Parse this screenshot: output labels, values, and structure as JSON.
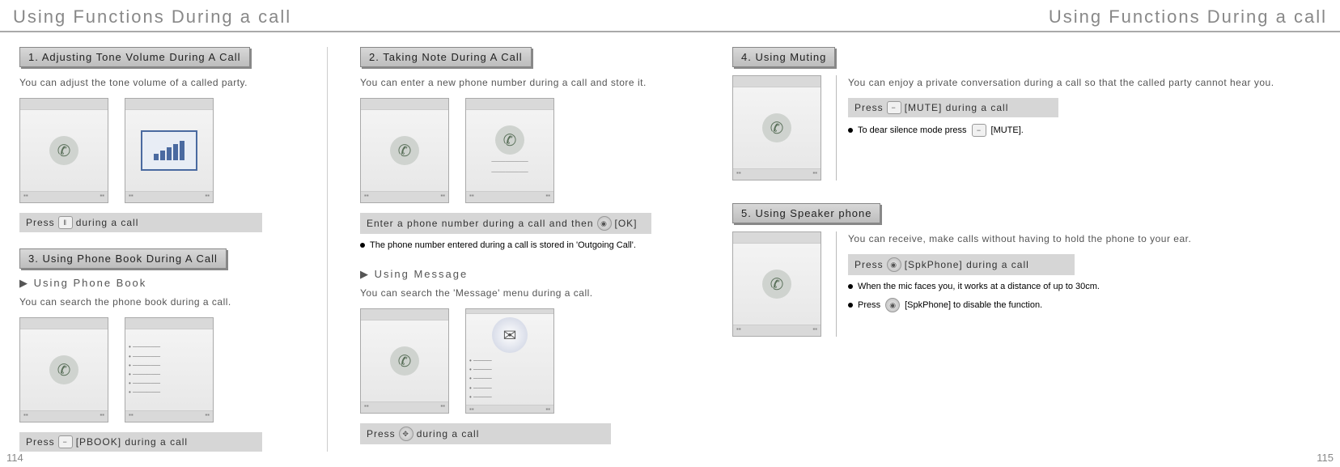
{
  "header": {
    "title_left": "Using Functions During a call",
    "title_right": "Using Functions During a call"
  },
  "sections": {
    "s1": {
      "title": "1. Adjusting Tone Volume During A Call",
      "desc": "You can adjust the tone volume of a called party.",
      "instruction_prefix": "Press",
      "instruction_suffix": "during a call"
    },
    "s2": {
      "title": "2. Taking Note During A Call",
      "desc": "You can enter a new phone number during a call and store it.",
      "instruction_prefix": "Enter a phone number during a call and then",
      "instruction_suffix": "[OK]",
      "bullet": "The phone number entered during a call is stored in 'Outgoing Call'."
    },
    "s3": {
      "title": "3. Using Phone Book During A Call",
      "sub_a": {
        "head": "▶ Using Phone Book",
        "desc": "You can search the phone book during a call.",
        "instruction_prefix": "Press ",
        "instruction_suffix": "[PBOOK] during a call"
      },
      "sub_b": {
        "head": "▶ Using Message",
        "desc": "You can search the 'Message' menu during a call.",
        "instruction_prefix": "Press ",
        "instruction_suffix": " during a call"
      }
    },
    "s4": {
      "title": "4. Using Muting",
      "desc": "You can enjoy a private conversation during a call so that the called party cannot hear you.",
      "instruction_prefix": "Press",
      "instruction_suffix": "[MUTE] during a call",
      "bullet_prefix": "To dear silence mode press",
      "bullet_suffix": "[MUTE]."
    },
    "s5": {
      "title": "5. Using Speaker phone",
      "desc": "You can receive, make calls without having to hold the phone to your ear.",
      "instruction_prefix": "Press ",
      "instruction_suffix": "[SpkPhone] during a call",
      "bullet1": "When the mic faces you, it works at a distance of up to 30cm.",
      "bullet2_prefix": "Press ",
      "bullet2_suffix": "[SpkPhone] to disable the function."
    }
  },
  "page_numbers": {
    "left": "114",
    "right": "115"
  }
}
